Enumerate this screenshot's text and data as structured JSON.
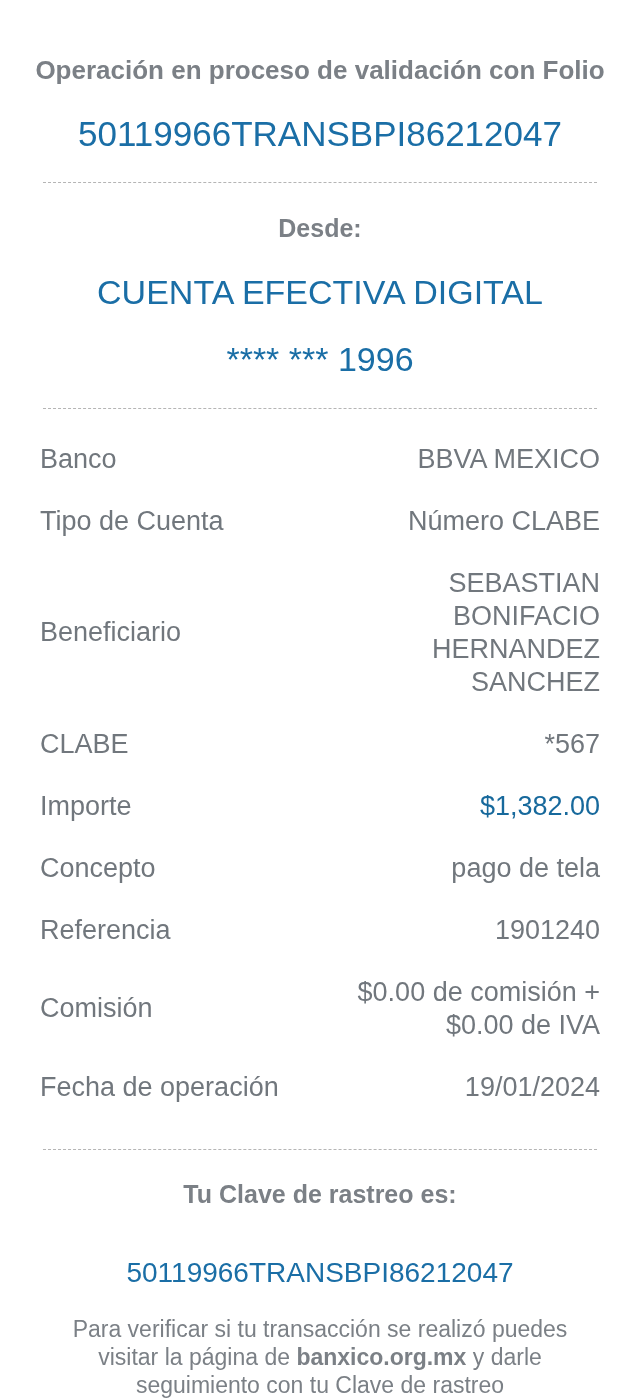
{
  "header": {
    "title": "Operación en proceso de validación con Folio",
    "folio": "50119966TRANSBPI86212047"
  },
  "origin": {
    "label": "Desde:",
    "account_name": "CUENTA EFECTIVA DIGITAL",
    "account_number": "**** *** 1996"
  },
  "details": [
    {
      "label": "Banco",
      "value": "BBVA MEXICO",
      "kind": "text"
    },
    {
      "label": "Tipo de Cuenta",
      "value": "Número CLABE",
      "kind": "text"
    },
    {
      "label": "Beneficiario",
      "value": "SEBASTIAN BONIFACIO HERNANDEZ SANCHEZ",
      "kind": "text"
    },
    {
      "label": "CLABE",
      "value": "*567",
      "kind": "text"
    },
    {
      "label": "Importe",
      "value": "$1,382.00",
      "kind": "amount"
    },
    {
      "label": "Concepto",
      "value": "pago de tela",
      "kind": "text"
    },
    {
      "label": "Referencia",
      "value": "1901240",
      "kind": "text"
    },
    {
      "label": "Comisión",
      "value": "$0.00 de comisión + $0.00 de IVA",
      "kind": "text"
    },
    {
      "label": "Fecha de operación",
      "value": "19/01/2024",
      "kind": "text"
    }
  ],
  "tracking": {
    "label": "Tu Clave de rastreo es:",
    "code": "50119966TRANSBPI86212047",
    "note": "Para verificar si tu transacción se realizó puedes visitar la página de **banxico.org.mx** y darle seguimiento con tu Clave de rastreo"
  }
}
